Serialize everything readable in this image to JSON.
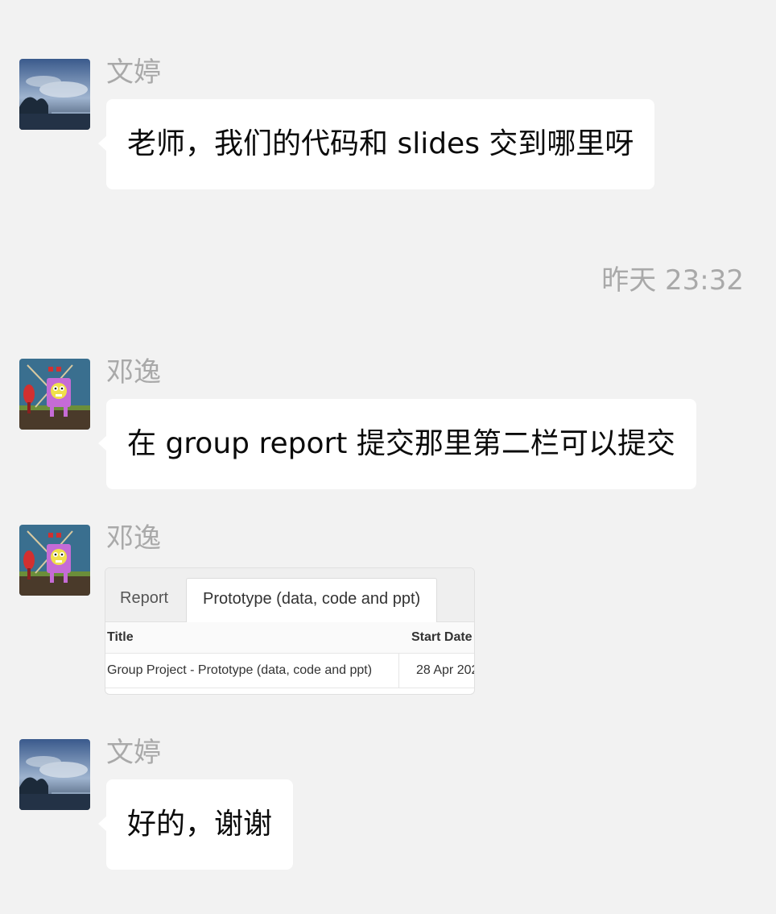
{
  "messages": [
    {
      "sender": "文婷",
      "text": "老师，我们的代码和 slides 交到哪里呀"
    },
    {
      "sender": "邓逸",
      "text": "在 group report 提交那里第二栏可以提交"
    },
    {
      "sender": "邓逸"
    },
    {
      "sender": "文婷",
      "text": "好的，谢谢"
    }
  ],
  "timestamp": "昨天 23:32",
  "screenshot": {
    "tabs": [
      "Report",
      "Prototype (data, code and ppt)"
    ],
    "columns": [
      "Title",
      "Start Date"
    ],
    "row": {
      "title": "Group Project - Prototype (data, code and ppt)",
      "start_date": "28 Apr 202"
    }
  },
  "colors": {
    "background": "#f2f2f2",
    "bubble": "#ffffff",
    "meta_text": "#a9a9a9"
  },
  "icons": {
    "avatar_1": "landscape-avatar-icon",
    "avatar_2": "cartoon-avatar-icon"
  }
}
